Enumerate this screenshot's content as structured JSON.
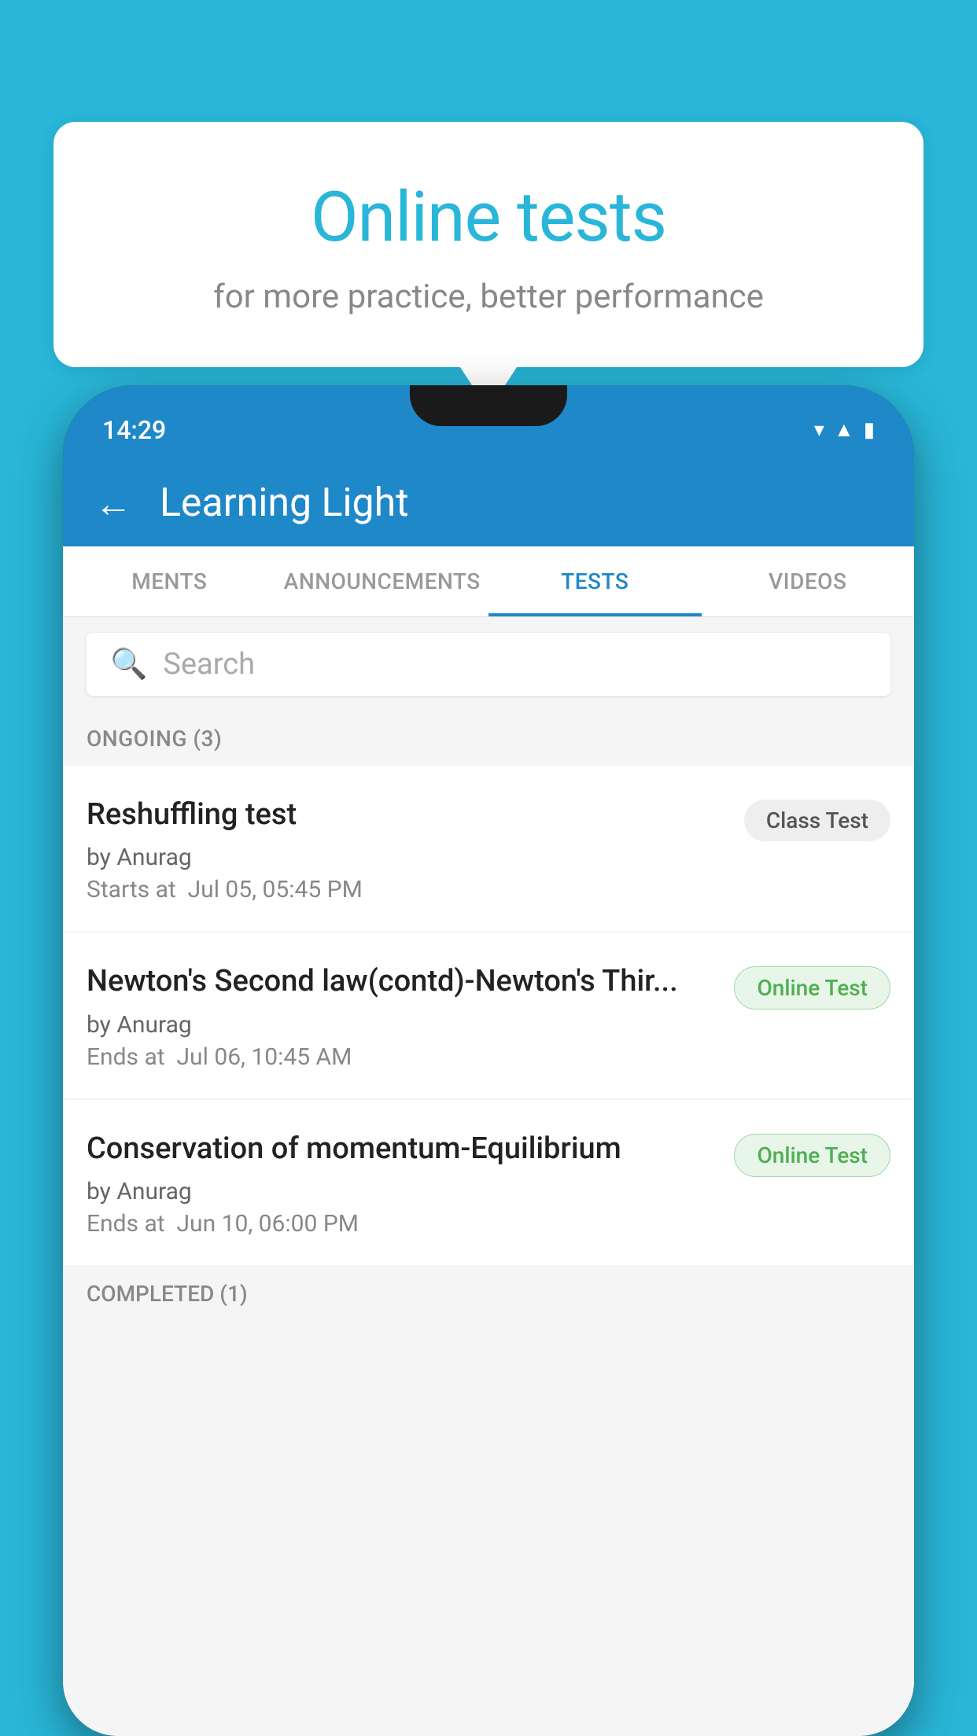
{
  "background_color": "#29b6d8",
  "speech_bubble": {
    "title": "Online tests",
    "subtitle": "for more practice, better performance"
  },
  "phone": {
    "status_bar": {
      "time": "14:29"
    },
    "header": {
      "title": "Learning Light",
      "back_label": "←"
    },
    "tabs": [
      {
        "label": "MENTS",
        "active": false
      },
      {
        "label": "ANNOUNCEMENTS",
        "active": false
      },
      {
        "label": "TESTS",
        "active": true
      },
      {
        "label": "VIDEOS",
        "active": false
      }
    ],
    "search": {
      "placeholder": "Search"
    },
    "sections": [
      {
        "label": "ONGOING (3)",
        "items": [
          {
            "name": "Reshuffling test",
            "author": "by Anurag",
            "time_label": "Starts at",
            "time": "Jul 05, 05:45 PM",
            "badge": "Class Test",
            "badge_type": "class"
          },
          {
            "name": "Newton's Second law(contd)-Newton's Thir...",
            "author": "by Anurag",
            "time_label": "Ends at",
            "time": "Jul 06, 10:45 AM",
            "badge": "Online Test",
            "badge_type": "online"
          },
          {
            "name": "Conservation of momentum-Equilibrium",
            "author": "by Anurag",
            "time_label": "Ends at",
            "time": "Jun 10, 06:00 PM",
            "badge": "Online Test",
            "badge_type": "online"
          }
        ]
      }
    ],
    "completed_section_label": "COMPLETED (1)"
  }
}
